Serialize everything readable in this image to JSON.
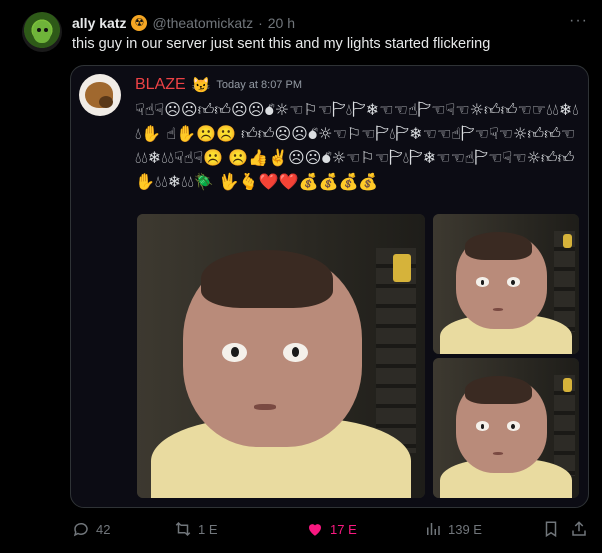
{
  "tweet": {
    "display_name": "ally katz",
    "badge_icon": "radioactive-icon",
    "handle": "@theatomickatz",
    "separator": "·",
    "time": "20 h",
    "more_label": "···",
    "text": "this guy in our server just sent this and my lights started flickering"
  },
  "embed": {
    "author": "BLAZE",
    "author_emoji": "😼",
    "timestamp": "Today at 8:07 PM",
    "message": "☟︎☝︎☟︎☹︎☹︎👍︎👍︎☹︎☹︎💣︎☼︎☜︎⚐︎☜︎🏱︎💧︎🏱︎❄︎☜︎☜︎☝︎🏱︎☜︎☟︎☜︎☼︎👍︎👍︎☜︎☞︎💧︎💧︎❄︎💧︎💧︎✋ ☝︎✋☹️☹️ 👍︎👍︎☹︎☹︎💣︎☼︎☜︎⚐︎☜︎🏱︎💧︎🏱︎❄︎☜︎☜︎☝︎🏱︎☜︎☟︎☜︎☼︎👍︎👍︎☜︎💧︎💧︎❄︎💧︎💧︎☟︎☝︎☟︎☹️ ☹️👍✌️☹︎☹︎💣︎☼︎☜︎⚐︎☜︎🏱︎💧︎🏱︎❄︎☜︎☜︎☝︎🏱︎☜︎☟︎☜︎☼︎👍︎👍︎✋💧︎💧︎❄︎💧︎💧︎🪲 🖖🫰❤️❤️💰💰💰💰"
  },
  "actions": {
    "reply_count": "42",
    "retweet_count": "1 E",
    "like_count": "17 E",
    "views_count": "139 E"
  },
  "colors": {
    "author": "#ed4245",
    "like": "#f91880",
    "muted": "#71767b"
  }
}
